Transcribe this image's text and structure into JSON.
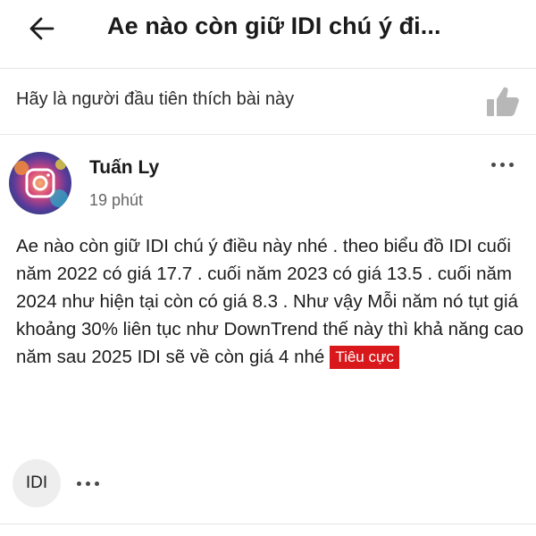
{
  "header": {
    "title": "Ae nào còn giữ IDI chú ý đi...",
    "back_icon": "arrow-left-icon"
  },
  "like_bar": {
    "prompt": "Hãy là người đầu tiên thích bài này",
    "like_icon": "thumbs-up-icon"
  },
  "comment": {
    "author": "Tuấn Ly",
    "time": "19 phút",
    "more_icon": "more-horizontal-icon",
    "body": "Ae nào còn giữ IDI chú ý điều này nhé .  theo biểu đồ  IDI  cuối năm 2022 có giá 17.7 . cuối năm 2023 có giá 13.5 . cuối năm 2024 như hiện tại còn có giá  8.3 .  Như vậy Mỗi năm nó tụt giá khoảng 30% liên tục như DownTrend thế này thì khả năng cao năm sau 2025 IDI sẽ về còn giá 4 nhé",
    "sentiment": "Tiêu cực",
    "sentiment_color": "#d9181c"
  },
  "footer": {
    "ticker": "IDI",
    "more_icon": "more-horizontal-icon"
  },
  "colors": {
    "divider": "#e6e6e6",
    "icon_gray": "#b7b7b7",
    "chip_bg": "#eeeeee"
  }
}
